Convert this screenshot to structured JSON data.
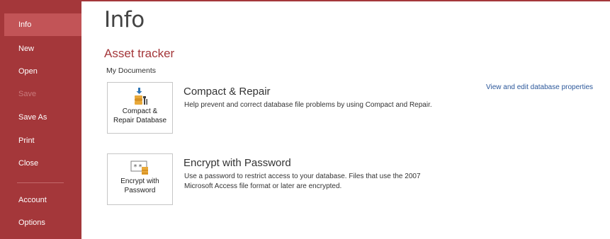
{
  "nav": {
    "items": [
      {
        "label": "Info",
        "selected": true,
        "disabled": false
      },
      {
        "label": "New",
        "selected": false,
        "disabled": false
      },
      {
        "label": "Open",
        "selected": false,
        "disabled": false
      },
      {
        "label": "Save",
        "selected": false,
        "disabled": true
      },
      {
        "label": "Save As",
        "selected": false,
        "disabled": false
      },
      {
        "label": "Print",
        "selected": false,
        "disabled": false
      },
      {
        "label": "Close",
        "selected": false,
        "disabled": false
      },
      {
        "label": "Account",
        "selected": false,
        "disabled": false
      },
      {
        "label": "Options",
        "selected": false,
        "disabled": false
      }
    ]
  },
  "page": {
    "title": "Info",
    "database_name": "Asset tracker",
    "database_location": "My Documents",
    "properties_link": "View and edit database properties"
  },
  "actions": [
    {
      "tile_label_line1": "Compact &",
      "tile_label_line2": "Repair Database",
      "title": "Compact & Repair",
      "description": "Help prevent and correct database file problems by using Compact and Repair.",
      "icon": "compact-repair-icon"
    },
    {
      "tile_label_line1": "Encrypt with",
      "tile_label_line2": "Password",
      "title": "Encrypt with Password",
      "description": "Use a password to restrict access to your database. Files that use the 2007 Microsoft Access file format or later are encrypted.",
      "icon": "encrypt-password-icon"
    }
  ],
  "colors": {
    "accent": "#a4373a",
    "nav_selected": "#c25457",
    "link": "#2b579a"
  }
}
